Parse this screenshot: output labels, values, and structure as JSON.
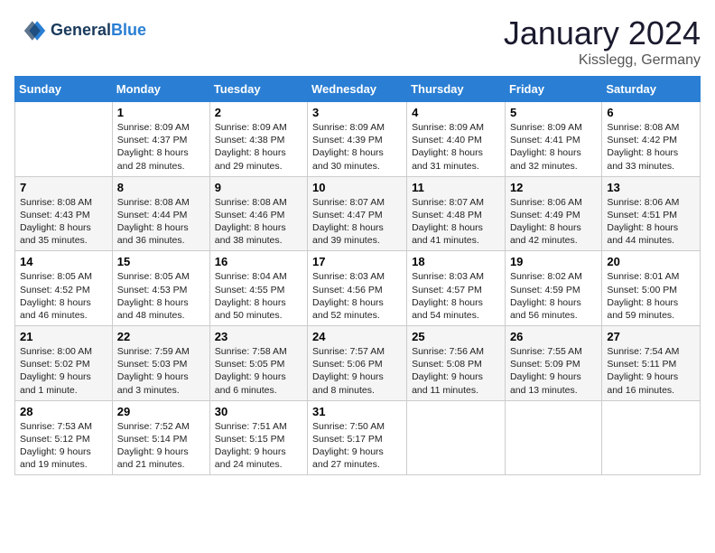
{
  "logo": {
    "line1": "General",
    "line2": "Blue"
  },
  "title": "January 2024",
  "location": "Kisslegg, Germany",
  "header_days": [
    "Sunday",
    "Monday",
    "Tuesday",
    "Wednesday",
    "Thursday",
    "Friday",
    "Saturday"
  ],
  "weeks": [
    [
      {
        "day": "",
        "sunrise": "",
        "sunset": "",
        "daylight": ""
      },
      {
        "day": "1",
        "sunrise": "Sunrise: 8:09 AM",
        "sunset": "Sunset: 4:37 PM",
        "daylight": "Daylight: 8 hours and 28 minutes."
      },
      {
        "day": "2",
        "sunrise": "Sunrise: 8:09 AM",
        "sunset": "Sunset: 4:38 PM",
        "daylight": "Daylight: 8 hours and 29 minutes."
      },
      {
        "day": "3",
        "sunrise": "Sunrise: 8:09 AM",
        "sunset": "Sunset: 4:39 PM",
        "daylight": "Daylight: 8 hours and 30 minutes."
      },
      {
        "day": "4",
        "sunrise": "Sunrise: 8:09 AM",
        "sunset": "Sunset: 4:40 PM",
        "daylight": "Daylight: 8 hours and 31 minutes."
      },
      {
        "day": "5",
        "sunrise": "Sunrise: 8:09 AM",
        "sunset": "Sunset: 4:41 PM",
        "daylight": "Daylight: 8 hours and 32 minutes."
      },
      {
        "day": "6",
        "sunrise": "Sunrise: 8:08 AM",
        "sunset": "Sunset: 4:42 PM",
        "daylight": "Daylight: 8 hours and 33 minutes."
      }
    ],
    [
      {
        "day": "7",
        "sunrise": "Sunrise: 8:08 AM",
        "sunset": "Sunset: 4:43 PM",
        "daylight": "Daylight: 8 hours and 35 minutes."
      },
      {
        "day": "8",
        "sunrise": "Sunrise: 8:08 AM",
        "sunset": "Sunset: 4:44 PM",
        "daylight": "Daylight: 8 hours and 36 minutes."
      },
      {
        "day": "9",
        "sunrise": "Sunrise: 8:08 AM",
        "sunset": "Sunset: 4:46 PM",
        "daylight": "Daylight: 8 hours and 38 minutes."
      },
      {
        "day": "10",
        "sunrise": "Sunrise: 8:07 AM",
        "sunset": "Sunset: 4:47 PM",
        "daylight": "Daylight: 8 hours and 39 minutes."
      },
      {
        "day": "11",
        "sunrise": "Sunrise: 8:07 AM",
        "sunset": "Sunset: 4:48 PM",
        "daylight": "Daylight: 8 hours and 41 minutes."
      },
      {
        "day": "12",
        "sunrise": "Sunrise: 8:06 AM",
        "sunset": "Sunset: 4:49 PM",
        "daylight": "Daylight: 8 hours and 42 minutes."
      },
      {
        "day": "13",
        "sunrise": "Sunrise: 8:06 AM",
        "sunset": "Sunset: 4:51 PM",
        "daylight": "Daylight: 8 hours and 44 minutes."
      }
    ],
    [
      {
        "day": "14",
        "sunrise": "Sunrise: 8:05 AM",
        "sunset": "Sunset: 4:52 PM",
        "daylight": "Daylight: 8 hours and 46 minutes."
      },
      {
        "day": "15",
        "sunrise": "Sunrise: 8:05 AM",
        "sunset": "Sunset: 4:53 PM",
        "daylight": "Daylight: 8 hours and 48 minutes."
      },
      {
        "day": "16",
        "sunrise": "Sunrise: 8:04 AM",
        "sunset": "Sunset: 4:55 PM",
        "daylight": "Daylight: 8 hours and 50 minutes."
      },
      {
        "day": "17",
        "sunrise": "Sunrise: 8:03 AM",
        "sunset": "Sunset: 4:56 PM",
        "daylight": "Daylight: 8 hours and 52 minutes."
      },
      {
        "day": "18",
        "sunrise": "Sunrise: 8:03 AM",
        "sunset": "Sunset: 4:57 PM",
        "daylight": "Daylight: 8 hours and 54 minutes."
      },
      {
        "day": "19",
        "sunrise": "Sunrise: 8:02 AM",
        "sunset": "Sunset: 4:59 PM",
        "daylight": "Daylight: 8 hours and 56 minutes."
      },
      {
        "day": "20",
        "sunrise": "Sunrise: 8:01 AM",
        "sunset": "Sunset: 5:00 PM",
        "daylight": "Daylight: 8 hours and 59 minutes."
      }
    ],
    [
      {
        "day": "21",
        "sunrise": "Sunrise: 8:00 AM",
        "sunset": "Sunset: 5:02 PM",
        "daylight": "Daylight: 9 hours and 1 minute."
      },
      {
        "day": "22",
        "sunrise": "Sunrise: 7:59 AM",
        "sunset": "Sunset: 5:03 PM",
        "daylight": "Daylight: 9 hours and 3 minutes."
      },
      {
        "day": "23",
        "sunrise": "Sunrise: 7:58 AM",
        "sunset": "Sunset: 5:05 PM",
        "daylight": "Daylight: 9 hours and 6 minutes."
      },
      {
        "day": "24",
        "sunrise": "Sunrise: 7:57 AM",
        "sunset": "Sunset: 5:06 PM",
        "daylight": "Daylight: 9 hours and 8 minutes."
      },
      {
        "day": "25",
        "sunrise": "Sunrise: 7:56 AM",
        "sunset": "Sunset: 5:08 PM",
        "daylight": "Daylight: 9 hours and 11 minutes."
      },
      {
        "day": "26",
        "sunrise": "Sunrise: 7:55 AM",
        "sunset": "Sunset: 5:09 PM",
        "daylight": "Daylight: 9 hours and 13 minutes."
      },
      {
        "day": "27",
        "sunrise": "Sunrise: 7:54 AM",
        "sunset": "Sunset: 5:11 PM",
        "daylight": "Daylight: 9 hours and 16 minutes."
      }
    ],
    [
      {
        "day": "28",
        "sunrise": "Sunrise: 7:53 AM",
        "sunset": "Sunset: 5:12 PM",
        "daylight": "Daylight: 9 hours and 19 minutes."
      },
      {
        "day": "29",
        "sunrise": "Sunrise: 7:52 AM",
        "sunset": "Sunset: 5:14 PM",
        "daylight": "Daylight: 9 hours and 21 minutes."
      },
      {
        "day": "30",
        "sunrise": "Sunrise: 7:51 AM",
        "sunset": "Sunset: 5:15 PM",
        "daylight": "Daylight: 9 hours and 24 minutes."
      },
      {
        "day": "31",
        "sunrise": "Sunrise: 7:50 AM",
        "sunset": "Sunset: 5:17 PM",
        "daylight": "Daylight: 9 hours and 27 minutes."
      },
      {
        "day": "",
        "sunrise": "",
        "sunset": "",
        "daylight": ""
      },
      {
        "day": "",
        "sunrise": "",
        "sunset": "",
        "daylight": ""
      },
      {
        "day": "",
        "sunrise": "",
        "sunset": "",
        "daylight": ""
      }
    ]
  ]
}
